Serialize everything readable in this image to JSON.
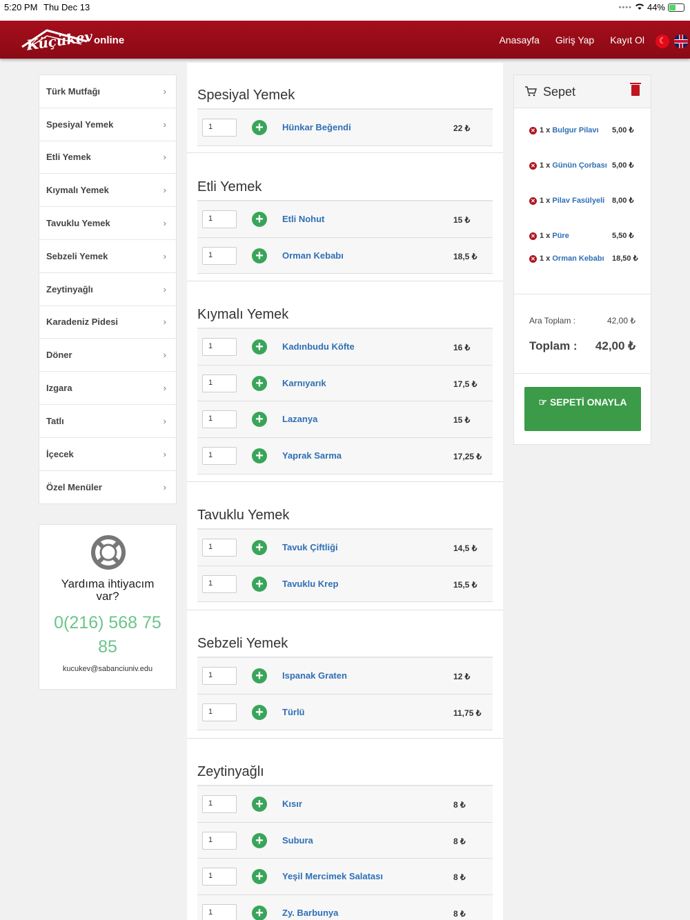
{
  "status_bar": {
    "time": "5:20 PM",
    "date": "Thu Dec 13",
    "battery": "44%",
    "battery_level": 0.44
  },
  "header": {
    "logo_text": "Küçükev",
    "logo_suffix": "online",
    "nav": [
      "Anasayfa",
      "Giriş Yap",
      "Kayıt Ol"
    ],
    "brand_color": "#9a0d18"
  },
  "categories": [
    "Türk Mutfağı",
    "Spesiyal Yemek",
    "Etli Yemek",
    "Kıymalı Yemek",
    "Tavuklu Yemek",
    "Sebzeli Yemek",
    "Zeytinyağlı",
    "Karadeniz Pidesi",
    "Döner",
    "Izgara",
    "Tatlı",
    "İçecek",
    "Özel Menüler"
  ],
  "help": {
    "title": "Yardıma ihtiyacım var?",
    "phone": "0(216) 568 75 85",
    "email": "kucukev@sabanciuniv.edu"
  },
  "sections": [
    {
      "title": "Spesiyal Yemek",
      "items": [
        {
          "qty": "1",
          "name": "Hünkar Beğendi",
          "price": "22 ₺"
        }
      ]
    },
    {
      "title": "Etli Yemek",
      "items": [
        {
          "qty": "1",
          "name": "Etli Nohut",
          "price": "15 ₺"
        },
        {
          "qty": "1",
          "name": "Orman Kebabı",
          "price": "18,5 ₺"
        }
      ]
    },
    {
      "title": "Kıymalı Yemek",
      "items": [
        {
          "qty": "1",
          "name": "Kadınbudu Köfte",
          "price": "16 ₺"
        },
        {
          "qty": "1",
          "name": "Karnıyarık",
          "price": "17,5 ₺"
        },
        {
          "qty": "1",
          "name": "Lazanya",
          "price": "15 ₺"
        },
        {
          "qty": "1",
          "name": "Yaprak Sarma",
          "price": "17,25 ₺"
        }
      ]
    },
    {
      "title": "Tavuklu Yemek",
      "items": [
        {
          "qty": "1",
          "name": "Tavuk Çiftliği",
          "price": "14,5 ₺"
        },
        {
          "qty": "1",
          "name": "Tavuklu Krep",
          "price": "15,5 ₺"
        }
      ]
    },
    {
      "title": "Sebzeli Yemek",
      "items": [
        {
          "qty": "1",
          "name": "Ispanak Graten",
          "price": "12 ₺"
        },
        {
          "qty": "1",
          "name": "Türlü",
          "price": "11,75 ₺"
        }
      ]
    },
    {
      "title": "Zeytinyağlı",
      "items": [
        {
          "qty": "1",
          "name": "Kısır",
          "price": "8 ₺"
        },
        {
          "qty": "1",
          "name": "Subura",
          "price": "8 ₺"
        },
        {
          "qty": "1",
          "name": "Yeşil Mercimek Salatası",
          "price": "8 ₺"
        },
        {
          "qty": "1",
          "name": "Zy. Barbunya",
          "price": "8 ₺"
        }
      ]
    }
  ],
  "cart": {
    "title": "Sepet",
    "items": [
      {
        "qty": "1 x",
        "name": "Bulgur Pilavı",
        "price": "5,00 ₺"
      },
      {
        "qty": "1 x",
        "name": "Günün Çorbası",
        "price": "5,00 ₺"
      },
      {
        "qty": "1 x",
        "name": "Pilav Fasülyeli",
        "price": "8,00 ₺"
      },
      {
        "qty": "1 x",
        "name": "Püre",
        "price": "5,50 ₺"
      },
      {
        "qty": "1 x",
        "name": "Orman Kebabı",
        "price": "18,50 ₺"
      }
    ],
    "subtotal_label": "Ara Toplam :",
    "subtotal": "42,00 ₺",
    "total_label": "Toplam :",
    "total": "42,00 ₺",
    "confirm_label": "SEPETİ ONAYLA"
  }
}
